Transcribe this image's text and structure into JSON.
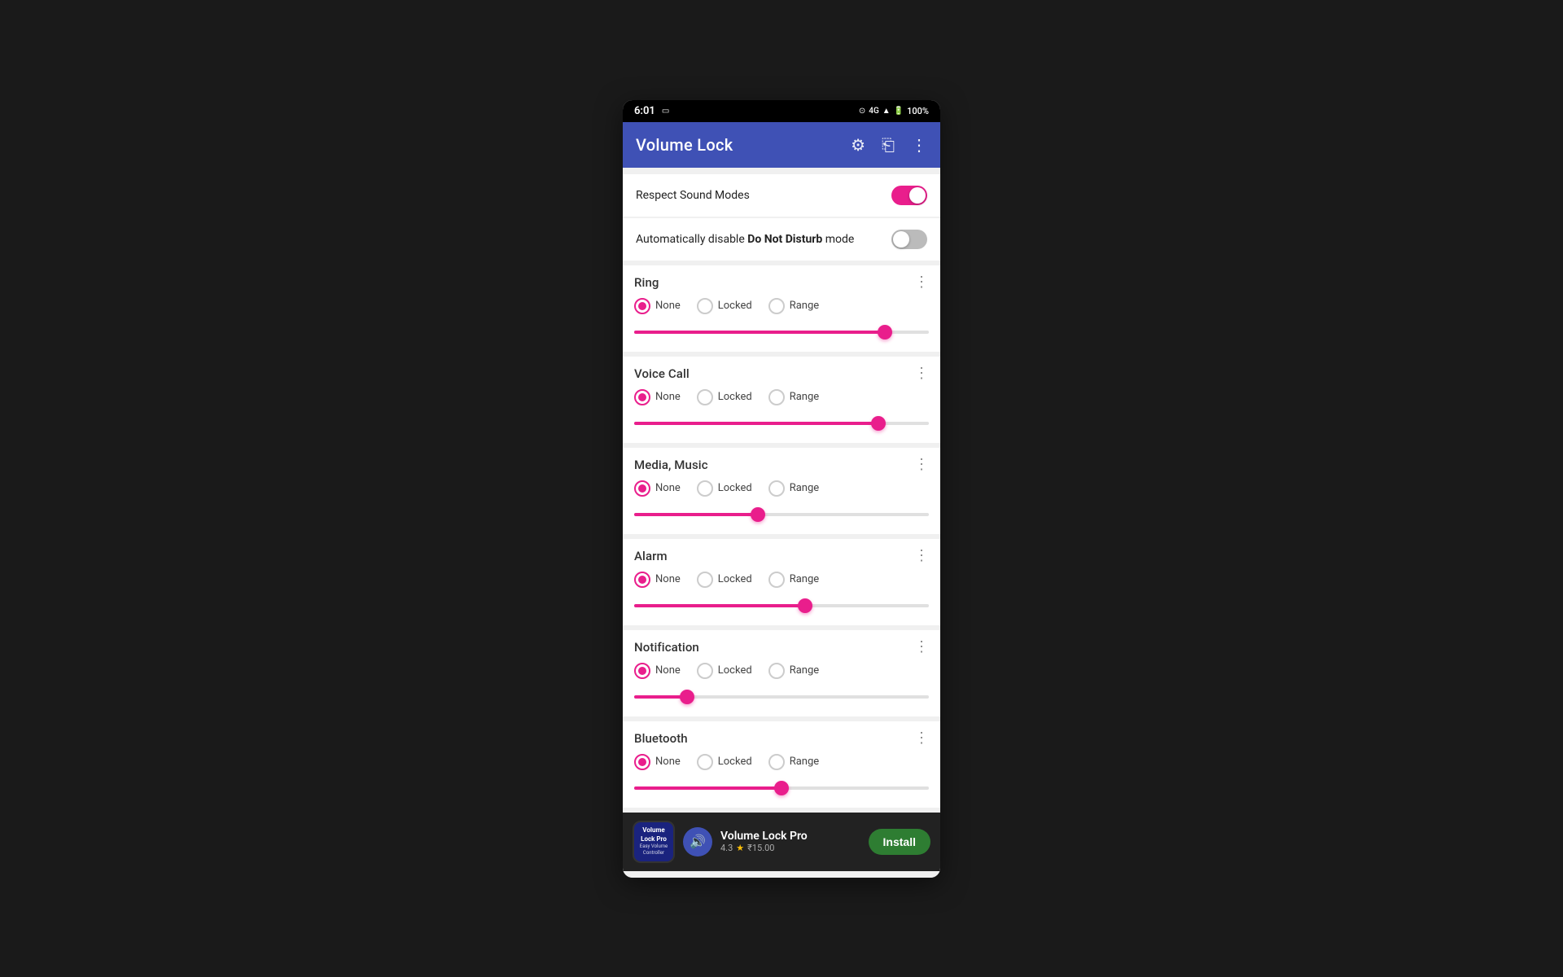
{
  "statusBar": {
    "time": "6:01",
    "batteryPercent": "100%"
  },
  "appBar": {
    "title": "Volume Lock",
    "settingsIcon": "⚙",
    "shareIcon": "⎗",
    "moreIcon": "⋮"
  },
  "settings": {
    "respectSoundModes": {
      "label": "Respect Sound Modes",
      "enabled": true
    },
    "autoDisableDND": {
      "labelPrefix": "Automatically disable ",
      "labelBold": "Do Not Disturb",
      "labelSuffix": " mode",
      "enabled": false
    }
  },
  "volumeCards": [
    {
      "id": "ring",
      "title": "Ring",
      "selectedOption": "None",
      "options": [
        "None",
        "Locked",
        "Range"
      ],
      "sliderPercent": 85
    },
    {
      "id": "voice-call",
      "title": "Voice Call",
      "selectedOption": "None",
      "options": [
        "None",
        "Locked",
        "Range"
      ],
      "sliderPercent": 83
    },
    {
      "id": "media-music",
      "title": "Media, Music",
      "selectedOption": "None",
      "options": [
        "None",
        "Locked",
        "Range"
      ],
      "sliderPercent": 42
    },
    {
      "id": "alarm",
      "title": "Alarm",
      "selectedOption": "None",
      "options": [
        "None",
        "Locked",
        "Range"
      ],
      "sliderPercent": 58
    },
    {
      "id": "notification",
      "title": "Notification",
      "selectedOption": "None",
      "options": [
        "None",
        "Locked",
        "Range"
      ],
      "sliderPercent": 18
    },
    {
      "id": "bluetooth",
      "title": "Bluetooth",
      "selectedOption": "None",
      "options": [
        "None",
        "Locked",
        "Range"
      ],
      "sliderPercent": 50
    }
  ],
  "banner": {
    "appIconTitle": "Volume Lock Pro",
    "appIconSub": "Easy Volume Controller",
    "appName": "Volume Lock Pro",
    "rating": "4.3",
    "ratingCount": "₹15.00",
    "installLabel": "Install"
  }
}
